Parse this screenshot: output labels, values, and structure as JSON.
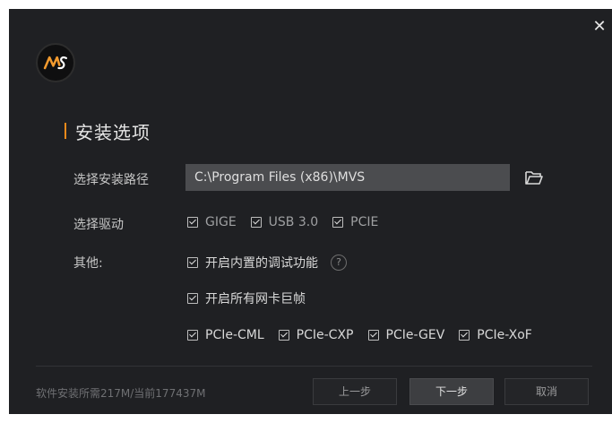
{
  "window": {
    "close_symbol": "✕"
  },
  "logo": {
    "text": "MVS"
  },
  "section": {
    "title": "安装选项"
  },
  "install_path": {
    "label": "选择安装路径",
    "value": "C:\\Program Files (x86)\\MVS"
  },
  "drivers": {
    "label": "选择驱动",
    "items": [
      {
        "label": "GIGE",
        "checked": true
      },
      {
        "label": "USB 3.0",
        "checked": true
      },
      {
        "label": "PCIE",
        "checked": true
      }
    ]
  },
  "other": {
    "label": "其他:",
    "debug": {
      "label": "开启内置的调试功能",
      "checked": true,
      "help": "?"
    },
    "jumbo": {
      "label": "开启所有网卡巨帧",
      "checked": true
    },
    "pcie_items": [
      {
        "label": "PCIe-CML",
        "checked": true
      },
      {
        "label": "PCIe-CXP",
        "checked": true
      },
      {
        "label": "PCIe-GEV",
        "checked": true
      },
      {
        "label": "PCIe-XoF",
        "checked": true
      }
    ]
  },
  "footer": {
    "space_info": "软件安装所需217M/当前177437M",
    "prev_label": "上一步",
    "next_label": "下一步",
    "cancel_label": "取消"
  },
  "colors": {
    "accent": "#f08a1a",
    "background": "#1f2023",
    "input_bg": "#4b4c4f"
  }
}
